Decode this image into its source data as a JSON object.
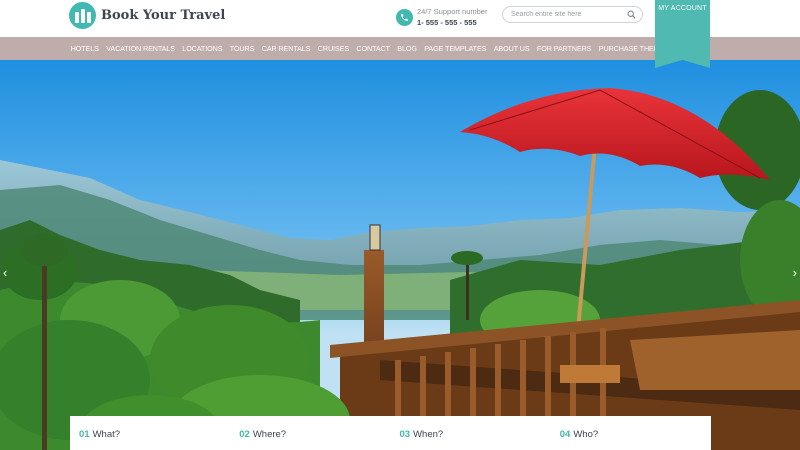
{
  "brand": {
    "name": "Book Your Travel",
    "accent": "#41b8b0"
  },
  "support": {
    "label": "24/7 Support number",
    "number": "1- 555 - 555 - 555",
    "icon": "phone-icon"
  },
  "search": {
    "placeholder": "Search entire site here",
    "icon": "search-icon"
  },
  "account": {
    "label": "MY ACCOUNT"
  },
  "nav": {
    "items": [
      {
        "label": "HOTELS"
      },
      {
        "label": "VACATION RENTALS"
      },
      {
        "label": "LOCATIONS"
      },
      {
        "label": "TOURS"
      },
      {
        "label": "CAR RENTALS"
      },
      {
        "label": "CRUISES"
      },
      {
        "label": "CONTACT"
      },
      {
        "label": "BLOG"
      },
      {
        "label": "PAGE TEMPLATES"
      },
      {
        "label": "ABOUT US"
      },
      {
        "label": "FOR PARTNERS"
      },
      {
        "label": "PURCHASE THEME"
      }
    ]
  },
  "slider": {
    "prev": "‹",
    "next": "›"
  },
  "search_steps": [
    {
      "num": "01",
      "label": "What?"
    },
    {
      "num": "02",
      "label": "Where?"
    },
    {
      "num": "03",
      "label": "When?"
    },
    {
      "num": "04",
      "label": "Who?"
    }
  ]
}
